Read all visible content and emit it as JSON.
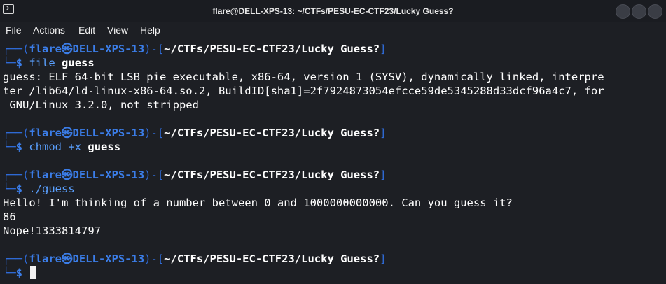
{
  "window": {
    "title": "flare@DELL-XPS-13: ~/CTFs/PESU-EC-CTF23/Lucky Guess?"
  },
  "menu": [
    "File",
    "Actions",
    "Edit",
    "View",
    "Help"
  ],
  "prompt": {
    "box_top": "┌──(",
    "user": "flare",
    "at_glyph": "㉿",
    "host": "DELL-XPS-13",
    "mid": ")-[",
    "path": "~/CTFs/PESU-EC-CTF23/Lucky Guess?",
    "close": "]",
    "box_bottom": "└─",
    "dollar": "$"
  },
  "block1": {
    "cmd": "file",
    "arg": "guess",
    "output": [
      "guess: ELF 64-bit LSB pie executable, x86-64, version 1 (SYSV), dynamically linked, interpre",
      "ter /lib64/ld-linux-x86-64.so.2, BuildID[sha1]=2f7924873054efcce59de5345288d33dcf96a4c7, for",
      " GNU/Linux 3.2.0, not stripped"
    ]
  },
  "block2": {
    "cmd": "chmod",
    "flag": "+x",
    "arg": "guess"
  },
  "block3": {
    "cmd": "./guess",
    "output": [
      "Hello! I'm thinking of a number between 0 and 1000000000000. Can you guess it?",
      "86",
      "Nope!1333814797"
    ]
  }
}
